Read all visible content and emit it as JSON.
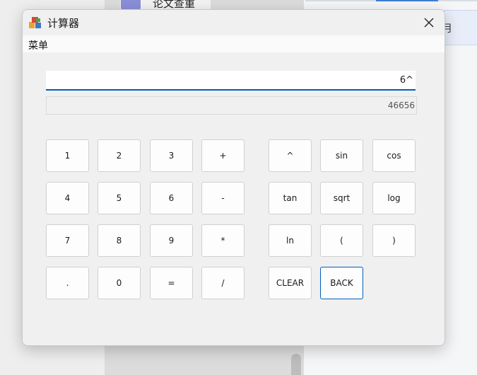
{
  "background": {
    "doc_label": "论文查重",
    "right_text": "月"
  },
  "window": {
    "title": "计算器",
    "menu": [
      "菜单"
    ]
  },
  "display": {
    "expression": "6^",
    "result": "46656"
  },
  "keys": {
    "k1": "1",
    "k2": "2",
    "k3": "3",
    "plus": "+",
    "k4": "4",
    "k5": "5",
    "k6": "6",
    "minus": "-",
    "k7": "7",
    "k8": "8",
    "k9": "9",
    "multiply": "*",
    "dot": ".",
    "k0": "0",
    "equals": "=",
    "divide": "/",
    "power": "^",
    "sin": "sin",
    "cos": "cos",
    "tan": "tan",
    "sqrt": "sqrt",
    "log": "log",
    "ln": "ln",
    "lparen": "(",
    "rparen": ")",
    "clear": "CLEAR",
    "back": "BACK"
  },
  "colors": {
    "accent": "#005fb8",
    "window_bg": "#f0f0f0"
  }
}
